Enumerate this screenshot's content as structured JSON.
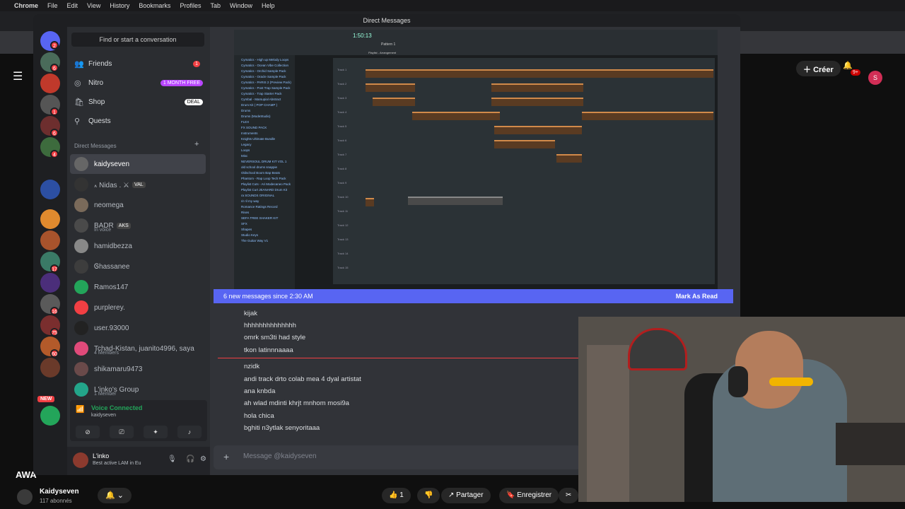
{
  "menubar": {
    "app": "Chrome",
    "items": [
      "File",
      "Edit",
      "View",
      "History",
      "Bookmarks",
      "Profiles",
      "Tab",
      "Window",
      "Help"
    ]
  },
  "youtube": {
    "create_label": "Créer",
    "notif_count": "9+",
    "avatar_letter": "S",
    "overlay_text": "AWA",
    "channel_name": "Kaidyseven",
    "channel_subs": "117 abonnés",
    "like_count": "1",
    "share_label": "Partager",
    "save_label": "Enregistrer"
  },
  "discord": {
    "window_title": "Direct Messages",
    "search_placeholder": "Find or start a conversation",
    "nav": [
      {
        "label": "Friends",
        "badge": "1"
      },
      {
        "label": "Nitro",
        "badge": "1 MONTH FREE"
      },
      {
        "label": "Shop",
        "badge": "DEAL"
      },
      {
        "label": "Quests",
        "badge": ""
      }
    ],
    "dm_header": "Direct Messages",
    "dms": [
      {
        "name": "kaidyseven",
        "sub": "",
        "tag": ""
      },
      {
        "name": "៱ Nidas . ⚔",
        "sub": "",
        "tag": "VAL"
      },
      {
        "name": "neomega",
        "sub": "",
        "tag": ""
      },
      {
        "name": "BADR",
        "sub": "In voice",
        "tag": "AKS"
      },
      {
        "name": "hamidbezza",
        "sub": "",
        "tag": ""
      },
      {
        "name": "Ꮆhassanee",
        "sub": "",
        "tag": ""
      },
      {
        "name": "Ramos147",
        "sub": "",
        "tag": ""
      },
      {
        "name": "purplerey.",
        "sub": "",
        "tag": ""
      },
      {
        "name": "user.93000",
        "sub": "",
        "tag": ""
      },
      {
        "name": "Tchad-Kistan, juanito4996, saya",
        "sub": "4 Members",
        "tag": ""
      },
      {
        "name": "shikamaru9473",
        "sub": "",
        "tag": ""
      },
      {
        "name": "L'inko's Group",
        "sub": "1 Member",
        "tag": ""
      }
    ],
    "server_badges": [
      "2",
      "6",
      "1",
      "6",
      "1",
      "1",
      "4",
      "1",
      "1",
      "4",
      "17",
      "75",
      "60",
      "16",
      "6"
    ],
    "new_badge": "NEW",
    "voice": {
      "title": "Voice Connected",
      "channel": "kaidyseven"
    },
    "user": {
      "name": "L'inko",
      "status": "Best active LAM in Eu"
    },
    "new_messages_banner": "6 new messages since 2:30 AM",
    "mark_as_read": "Mark As Read",
    "messages": [
      "kijak",
      "hhhhhhhhhhhhhh",
      "omrk sm3ti had style",
      "tkon latinnnaaaa",
      "nzidk",
      "andi track  drto colab mea 4 dyal artistat",
      "ana knbda",
      "ah wlad mdinti khrjt mnhom mosi9a",
      "hola chica",
      "bghiti n3ytlak senyoritaaa"
    ],
    "composer_placeholder": "Message @kaidyseven"
  },
  "daw": {
    "tempo": "1:50:13",
    "pattern": "Pattern 1",
    "playlist_title": "Playlist - Arrangement",
    "browser_items": [
      "Cymatics - High up Melody Loops",
      "Cymatics - Ocean Vibe Collection",
      "Cymatics - Orchid Sample Pack",
      "Cymatics - Oracle Sample Pack",
      "Cymatics - PARIS 2 (Preview Pack)",
      "Cymatics - Post Trap Sample Pack",
      "Cymatics - Trap Starter Pack",
      "Cymbal - Marsupial Abstract",
      "Drum Kit ( POP CHAMP )",
      "Drums",
      "Drums (ModeStudio)",
      "FLEX",
      "FX SOUND PACK",
      "Instruments",
      "Knights Ultimate Bundle",
      "Legacy",
      "Loops",
      "Misc",
      "NEVERSOUL DRUM KIT VOL 1",
      "old school drums snappie",
      "Oldschool Boom Bap Beats",
      "Phantom - Rap Loop Tech Pack",
      "Playlist Cuts - Ari Modecaneo Pack",
      "Playlist Curt JEANARD Drum Kit",
      "ra SOUNDS ORIGINAL",
      "rir ril my way",
      "Romance Ratings Record",
      "Rises",
      "SEFA TREE SHAKER KIT",
      "SFX",
      "Shapes",
      "Studio Keys",
      "The Guitar Way V1"
    ],
    "tracks": [
      "Track 1",
      "Track 2",
      "Track 3",
      "Track 4",
      "Track 5",
      "Track 6",
      "Track 7",
      "Track 8",
      "Track 9",
      "Track 10",
      "Track 11",
      "Track 12",
      "Track 13",
      "Track 14",
      "Track 15"
    ]
  }
}
